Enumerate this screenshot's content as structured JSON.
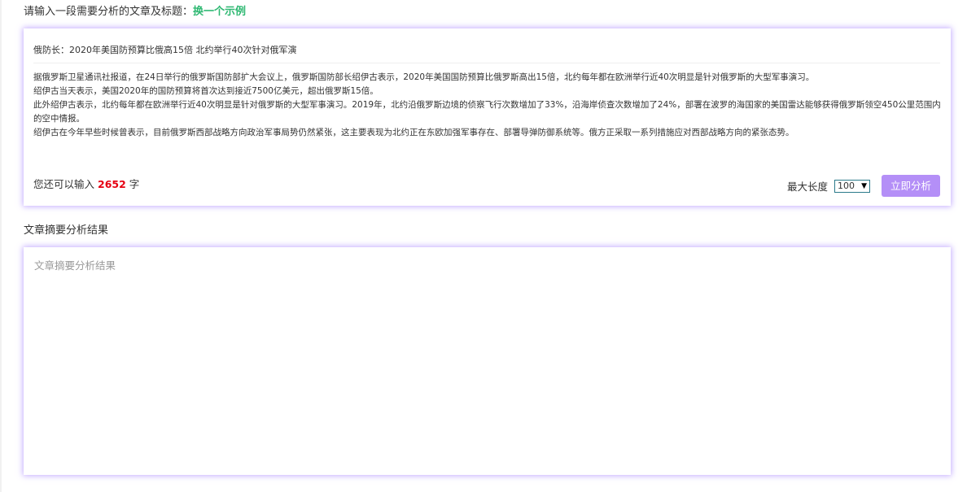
{
  "prompt": {
    "label": "请输入一段需要分析的文章及标题：",
    "example_link": "换一个示例"
  },
  "article": {
    "title": "俄防长：2020年美国防预算比俄高15倍 北约举行40次针对俄军演",
    "paragraphs": [
      "据俄罗斯卫星通讯社报道，在24日举行的俄罗斯国防部扩大会议上，俄罗斯国防部长绍伊古表示，2020年美国国防预算比俄罗斯高出15倍，北约每年都在欧洲举行近40次明显是针对俄罗斯的大型军事演习。",
      "绍伊古当天表示，美国2020年的国防预算将首次达到接近7500亿美元，超出俄罗斯15倍。",
      "此外绍伊古表示，北约每年都在欧洲举行近40次明显是针对俄罗斯的大型军事演习。2019年，北约沿俄罗斯边境的侦察飞行次数增加了33%，沿海岸侦查次数增加了24%，部署在波罗的海国家的美国雷达能够获得俄罗斯领空450公里范围内的空中情报。",
      "绍伊古在今年早些时候曾表示，目前俄罗斯西部战略方向政治军事局势仍然紧张，这主要表现为北约正在东欧加强军事存在、部署导弹防御系统等。俄方正采取一系列措施应对西部战略方向的紧张态势。"
    ]
  },
  "counter": {
    "prefix": "您还可以输入",
    "remaining": "2652",
    "suffix": "字"
  },
  "controls": {
    "max_length_label": "最大长度",
    "max_length_value": "100",
    "analyze_button": "立即分析"
  },
  "result": {
    "heading": "文章摘要分析结果",
    "placeholder": "文章摘要分析结果"
  },
  "colors": {
    "accent_purple": "#b48ff7",
    "link_green": "#2eb872",
    "count_red": "#e60012"
  },
  "icons": {
    "select_arrow": "dropdown-arrow-icon"
  }
}
